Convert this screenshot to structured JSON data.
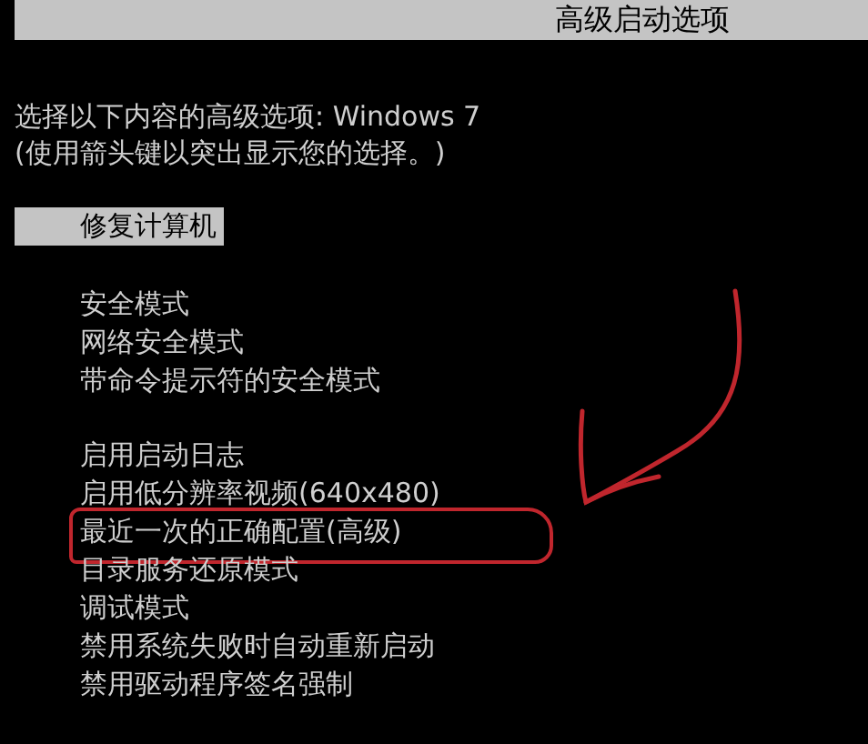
{
  "header": {
    "title": "高级启动选项"
  },
  "prompt": [
    "选择以下内容的高级选项: Windows 7",
    "(使用箭头键以突出显示您的选择。)"
  ],
  "menu_groups": [
    {
      "items": [
        {
          "label": "修复计算机",
          "selected": true,
          "circled": false
        }
      ]
    },
    {
      "items": [
        {
          "label": "安全模式",
          "selected": false,
          "circled": false
        },
        {
          "label": "网络安全模式",
          "selected": false,
          "circled": false
        },
        {
          "label": "带命令提示符的安全模式",
          "selected": false,
          "circled": false
        }
      ]
    },
    {
      "items": [
        {
          "label": "启用启动日志",
          "selected": false,
          "circled": false
        },
        {
          "label": "启用低分辨率视频(640x480)",
          "selected": false,
          "circled": false
        },
        {
          "label": "最近一次的正确配置(高级)",
          "selected": false,
          "circled": true
        },
        {
          "label": "目录服务还原模式",
          "selected": false,
          "circled": false
        },
        {
          "label": "调试模式",
          "selected": false,
          "circled": false
        },
        {
          "label": "禁用系统失败时自动重新启动",
          "selected": false,
          "circled": false
        },
        {
          "label": "禁用驱动程序签名强制",
          "selected": false,
          "circled": false
        }
      ]
    }
  ]
}
